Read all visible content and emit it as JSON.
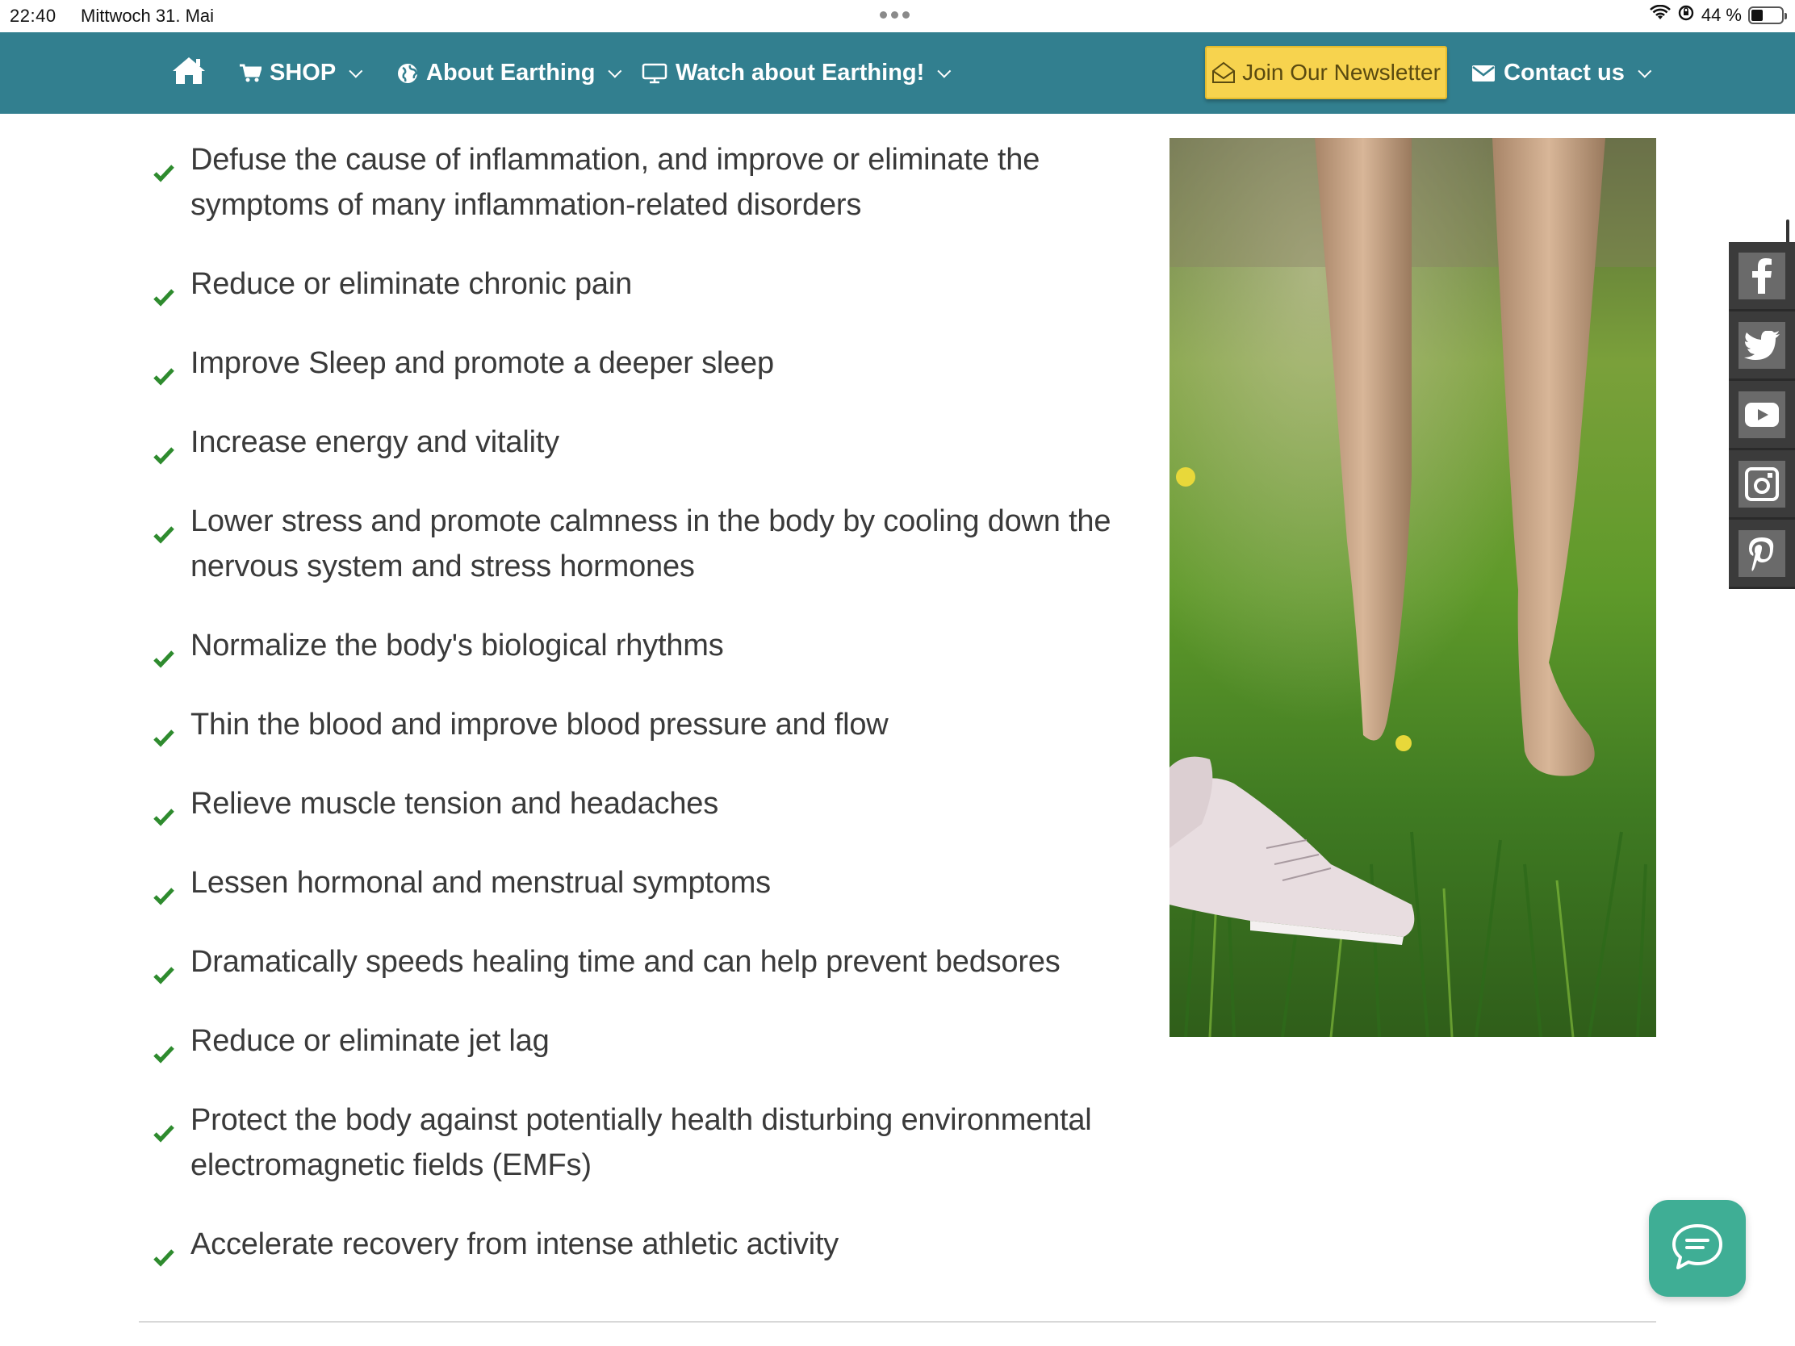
{
  "status_bar": {
    "time": "22:40",
    "date": "Mittwoch 31. Mai",
    "battery": "44 %"
  },
  "nav": {
    "home_icon": "home-icon",
    "shop_label": "SHOP",
    "about_label": "About Earthing",
    "watch_label": "Watch about Earthing!",
    "newsletter_label": "Join Our Newsletter",
    "contact_label": "Contact us",
    "bar_color": "#327f8f",
    "newsletter_color": "#f7d34e"
  },
  "benefits": [
    "Defuse the cause of inflammation, and improve or eliminate the symptoms of many inflammation-related disorders",
    "Reduce or eliminate chronic pain",
    "Improve Sleep and promote a deeper sleep",
    "Increase energy and vitality",
    "Lower stress and promote calmness in the body by cooling down the nervous system and stress hormones",
    "Normalize the body's biological rhythms",
    "Thin the blood and improve blood pressure and flow",
    "Relieve muscle tension and headaches",
    "Lessen hormonal and menstrual symptoms",
    "Dramatically speeds healing time and can help prevent bedsores",
    "Reduce or eliminate jet lag",
    "Protect the body against potentially health disturbing environmental electromagnetic fields (EMFs)",
    "Accelerate recovery from intense athletic activity"
  ],
  "check_color": "#2e8b2e",
  "social": [
    "facebook-icon",
    "twitter-icon",
    "youtube-icon",
    "instagram-icon",
    "pinterest-icon"
  ],
  "chat_icon": "chat-icon",
  "chat_color": "#3fae95"
}
